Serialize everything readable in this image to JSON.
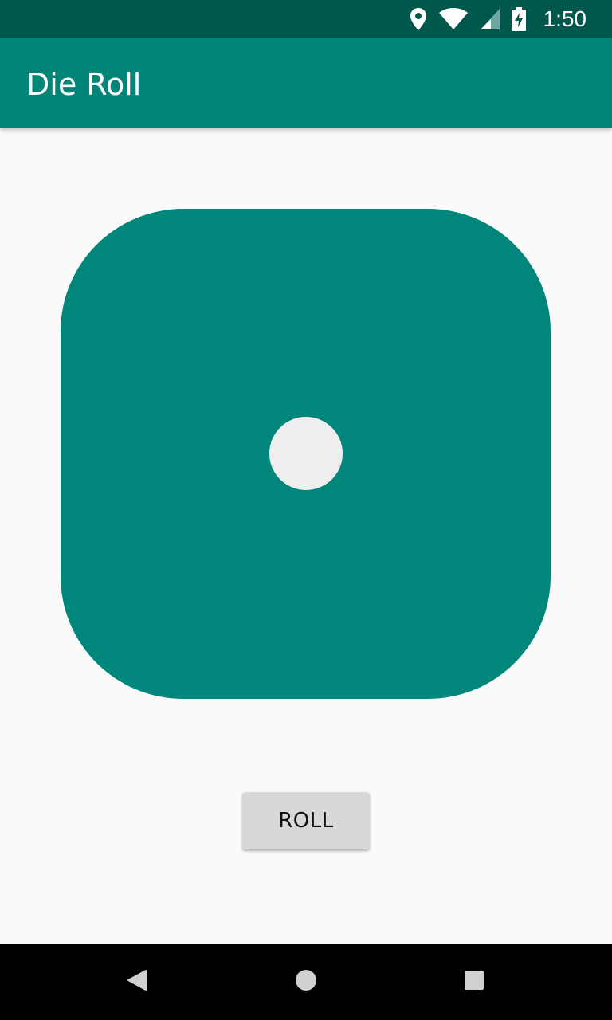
{
  "status_bar": {
    "time": "1:50",
    "icons": [
      "location-icon",
      "wifi-icon",
      "signal-icon",
      "battery-charging-icon"
    ]
  },
  "app_bar": {
    "title": "Die Roll"
  },
  "die": {
    "face_value": 1
  },
  "roll_button": {
    "label": "ROLL"
  },
  "nav_bar": {
    "icons": [
      "back-icon",
      "home-icon",
      "recents-icon"
    ]
  },
  "colors": {
    "status_bar": "#00574b",
    "app_bar": "#008577",
    "die": "#00867a",
    "pip": "#eeeeee",
    "background": "#fafafa",
    "button": "#d8d8d8"
  }
}
